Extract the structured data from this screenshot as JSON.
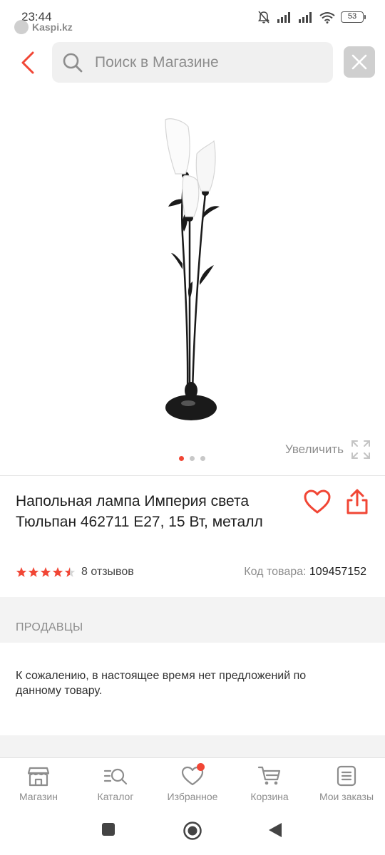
{
  "status_bar": {
    "time": "23:44",
    "app_label": "Kaspi.kz",
    "battery": "53",
    "icons": [
      "bell-off-icon",
      "signal-icon",
      "signal-icon",
      "wifi-icon",
      "battery-icon"
    ]
  },
  "search": {
    "placeholder": "Поиск в Магазине",
    "value": ""
  },
  "gallery": {
    "image_alt": "Напольная лампа",
    "slide_count": 3,
    "active_slide": 1,
    "zoom_label": "Увеличить"
  },
  "product": {
    "title": "Напольная лампа Империя света Тюльпан 462711 E27, 15 Вт, металл",
    "rating": 4.5,
    "reviews": "8 отзывов",
    "code_label": "Код товара:",
    "code_value": "109457152"
  },
  "sellers": {
    "heading": "ПРОДАВЦЫ",
    "message": "К сожалению, в настоящее время нет предложений по данному товару."
  },
  "bottom_nav": {
    "items": [
      {
        "label": "Магазин",
        "icon": "store-icon"
      },
      {
        "label": "Каталог",
        "icon": "catalog-search-icon"
      },
      {
        "label": "Избранное",
        "icon": "heart-icon",
        "badge": true
      },
      {
        "label": "Корзина",
        "icon": "cart-icon"
      },
      {
        "label": "Мои заказы",
        "icon": "orders-icon"
      }
    ]
  },
  "colors": {
    "accent": "#f14635",
    "muted": "#8d8d8d",
    "band": "#f3f3f3"
  }
}
